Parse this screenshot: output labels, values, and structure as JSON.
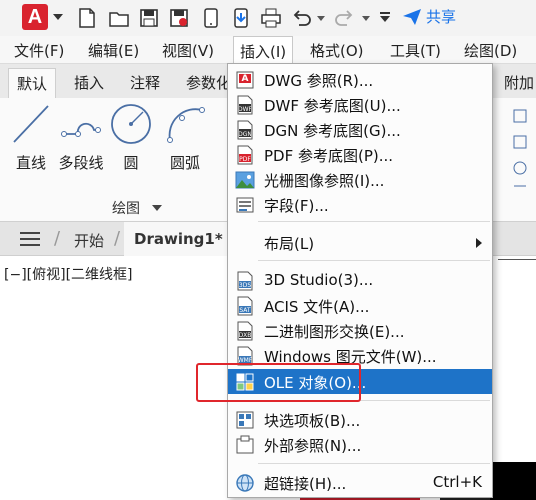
{
  "app": {
    "logo_letter": "A",
    "share_label": "共享"
  },
  "menubar": {
    "items": [
      "文件(F)",
      "编辑(E)",
      "视图(V)",
      "插入(I)",
      "格式(O)",
      "工具(T)",
      "绘图(D)"
    ]
  },
  "ribbon_tabs": [
    "默认",
    "插入",
    "注释",
    "参数化",
    "附加"
  ],
  "ribbon": {
    "tools": [
      "直线",
      "多段线",
      "圆",
      "圆弧"
    ],
    "group_label": "绘图"
  },
  "doc_tabs": {
    "start": "开始",
    "current": "Drawing1*"
  },
  "viewport_label": "[−][俯视][二维线框]",
  "insert_menu": {
    "items": [
      {
        "icon": "dwg-reference-icon",
        "label": "DWG 参照(R)..."
      },
      {
        "icon": "dwf-underlay-icon",
        "label": "DWF 参考底图(U)..."
      },
      {
        "icon": "dgn-underlay-icon",
        "label": "DGN 参考底图(G)..."
      },
      {
        "icon": "pdf-underlay-icon",
        "label": "PDF 参考底图(P)..."
      },
      {
        "icon": "raster-image-icon",
        "label": "光栅图像参照(I)..."
      },
      {
        "icon": "field-icon",
        "label": "字段(F)..."
      },
      {
        "icon": "",
        "label": "布局(L)",
        "submenu": true
      },
      {
        "icon": "3ds-icon",
        "label": "3D Studio(3)..."
      },
      {
        "icon": "sat-icon",
        "label": "ACIS 文件(A)..."
      },
      {
        "icon": "dxb-icon",
        "label": "二进制图形交换(E)..."
      },
      {
        "icon": "wmf-icon",
        "label": "Windows 图元文件(W)..."
      },
      {
        "icon": "ole-object-icon",
        "label": "OLE 对象(O)...",
        "highlighted": true
      },
      {
        "icon": "tool-palette-icon",
        "label": "块选项板(B)..."
      },
      {
        "icon": "xref-icon",
        "label": "外部参照(N)..."
      },
      {
        "icon": "hyperlink-icon",
        "label": "超链接(H)...",
        "shortcut": "Ctrl+K"
      }
    ]
  },
  "colors": {
    "highlight": "#1e73c8",
    "annotation_box": "#e0262c",
    "share": "#1a73e8",
    "logo": "#d9232e"
  }
}
